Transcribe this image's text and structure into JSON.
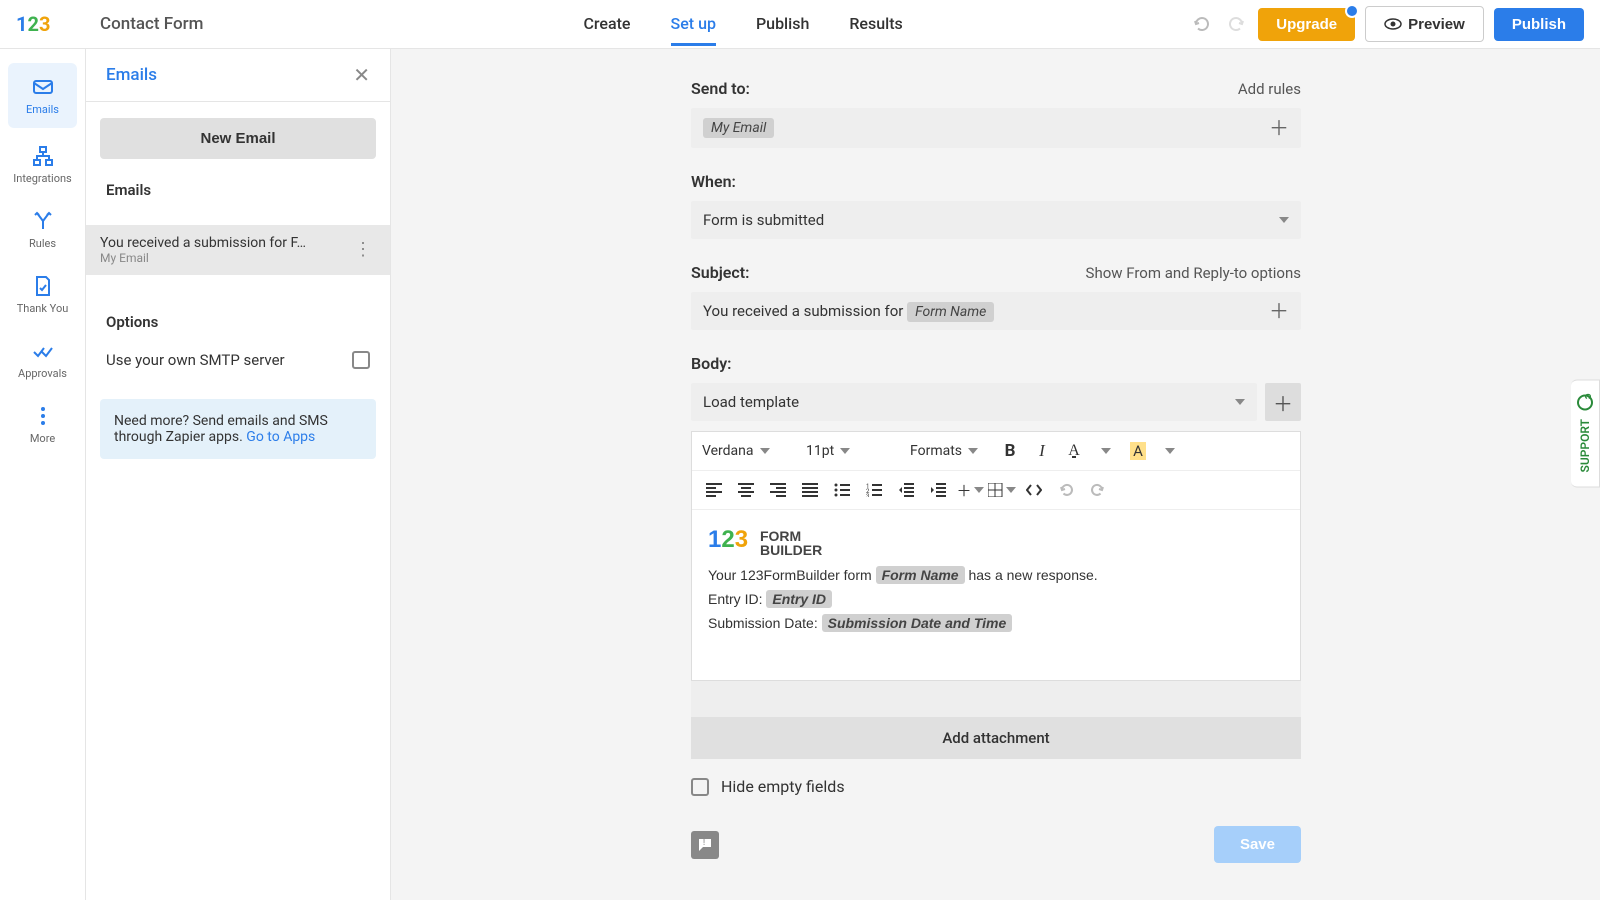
{
  "header": {
    "form_title": "Contact Form",
    "tabs": [
      "Create",
      "Set up",
      "Publish",
      "Results"
    ],
    "active_tab": 1,
    "upgrade_label": "Upgrade",
    "preview_label": "Preview",
    "publish_label": "Publish"
  },
  "leftnav": {
    "items": [
      {
        "label": "Emails",
        "icon": "mail"
      },
      {
        "label": "Integrations",
        "icon": "nodes"
      },
      {
        "label": "Rules",
        "icon": "branch"
      },
      {
        "label": "Thank You",
        "icon": "page"
      },
      {
        "label": "Approvals",
        "icon": "checks"
      },
      {
        "label": "More",
        "icon": "dots"
      }
    ],
    "active_index": 0
  },
  "sidepanel": {
    "title": "Emails",
    "new_email_label": "New Email",
    "list_header": "Emails",
    "email_item": {
      "title": "You received a submission for F…",
      "subtitle": "My Email"
    },
    "options_header": "Options",
    "smtp_label": "Use your own SMTP server",
    "info_text": "Need more? Send emails and SMS through Zapier apps. ",
    "info_link": "Go to Apps"
  },
  "main": {
    "send_to": {
      "label": "Send to:",
      "rules_link": "Add rules",
      "chip": "My Email"
    },
    "when": {
      "label": "When:",
      "value": "Form is submitted"
    },
    "from_link": "Show From and Reply-to options",
    "subject": {
      "label": "Subject:",
      "prefix": "You received a submission for ",
      "chip": "Form Name"
    },
    "body": {
      "label": "Body:",
      "load_template": "Load template",
      "font_family": "Verdana",
      "font_size": "11pt",
      "formats_label": "Formats",
      "logo_line1": "FORM",
      "logo_line2": "BUILDER",
      "line1_pre": "Your 123FormBuilder form ",
      "line1_chip": "Form Name",
      "line1_post": " has a new response.",
      "line2_pre": "Entry ID: ",
      "line2_chip": "Entry ID",
      "line3_pre": "Submission Date: ",
      "line3_chip": "Submission Date and Time"
    },
    "add_attachment": "Add attachment",
    "hide_empty": "Hide empty fields",
    "save_label": "Save"
  },
  "support_label": "SUPPORT"
}
